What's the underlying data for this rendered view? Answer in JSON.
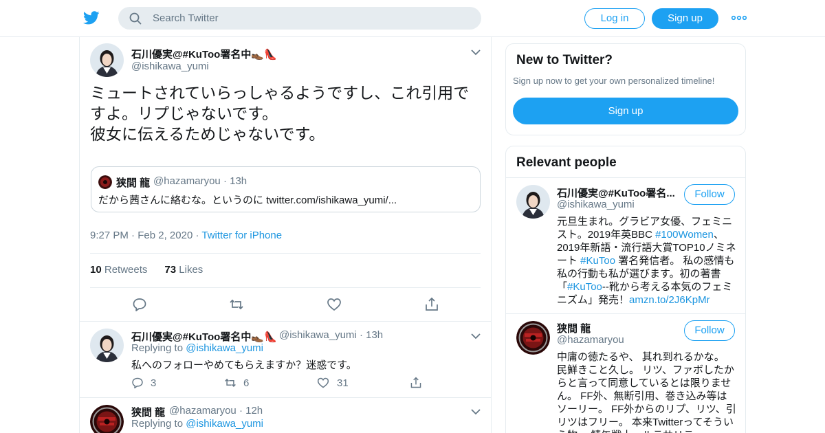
{
  "search": {
    "placeholder": "Search Twitter"
  },
  "header": {
    "login_label": "Log in",
    "signup_label": "Sign up"
  },
  "tweet": {
    "author_name": "石川優実@#KuToo署名中👞👠",
    "author_handle": "@ishikawa_yumi",
    "text": "ミュートされていらっしゃるようですし、これ引用ですよ。リプじゃないです。\n彼女に伝えるためじゃないです。",
    "quote": {
      "name": "狭間 龍",
      "handle": "@hazamaryou",
      "time": "13h",
      "text_prefix": "だから茜さんに絡むな。というのに ",
      "link": "twitter.com/ishikawa_yumi/..."
    },
    "time": "9:27 PM",
    "date": "Feb 2, 2020",
    "source": "Twitter for iPhone",
    "retweets_count": "10",
    "retweets_label": "Retweets",
    "likes_count": "73",
    "likes_label": "Likes"
  },
  "replies": [
    {
      "name": "石川優実@#KuToo署名中👞👠",
      "handle": "@ishikawa_yumi",
      "time": "13h",
      "replying_label": "Replying to",
      "replying_to": "@ishikawa_yumi",
      "text": "私へのフォローやめてもらえますか？迷惑です。",
      "reply_count": "3",
      "retweet_count": "6",
      "like_count": "31"
    },
    {
      "name": "狭間 龍",
      "handle": "@hazamaryou",
      "time": "12h",
      "replying_label": "Replying to",
      "replying_to": "@ishikawa_yumi"
    }
  ],
  "sidebar": {
    "new_title": "New to Twitter?",
    "new_desc": "Sign up now to get your own personalized timeline!",
    "signup_label": "Sign up",
    "relevant_title": "Relevant people",
    "people": [
      {
        "name": "石川優実@#KuToo署名...",
        "handle": "@ishikawa_yumi",
        "follow_label": "Follow",
        "bio_1": "元旦生まれ。グラビア女優、フェミニスト。2019年英BBC ",
        "bio_tag1": "#100Women",
        "bio_2": "、2019年新語・流行語大賞TOP10ノミネート ",
        "bio_tag2": "#KuToo",
        "bio_3": " 署名発信者。 私の感情も私の行動も私が選びます。初の著書「",
        "bio_tag3": "#KuToo",
        "bio_4": "--靴から考える本気のフェミニズム」発売！",
        "bio_link": "amzn.to/2J6KpMr"
      },
      {
        "name": "狭間 龍",
        "handle": "@hazamaryou",
        "follow_label": "Follow",
        "bio": "中庸の徳たるや、 其れ到れるかな。 民鮮きこと久し。 リツ、ファボしたからと言って同意しているとは限りません。 FF外、無断引用、巻き込み等はソーリー。 FF外からのリプ、リツ、引リツはフリー。 本来Twitterってそういう物。 鯖缶戦士　ルラサリテ"
      }
    ]
  },
  "colors": {
    "brand": "#1da1f2",
    "link": "#1b95e0",
    "muted": "#657786",
    "border": "#e6ecf0"
  }
}
